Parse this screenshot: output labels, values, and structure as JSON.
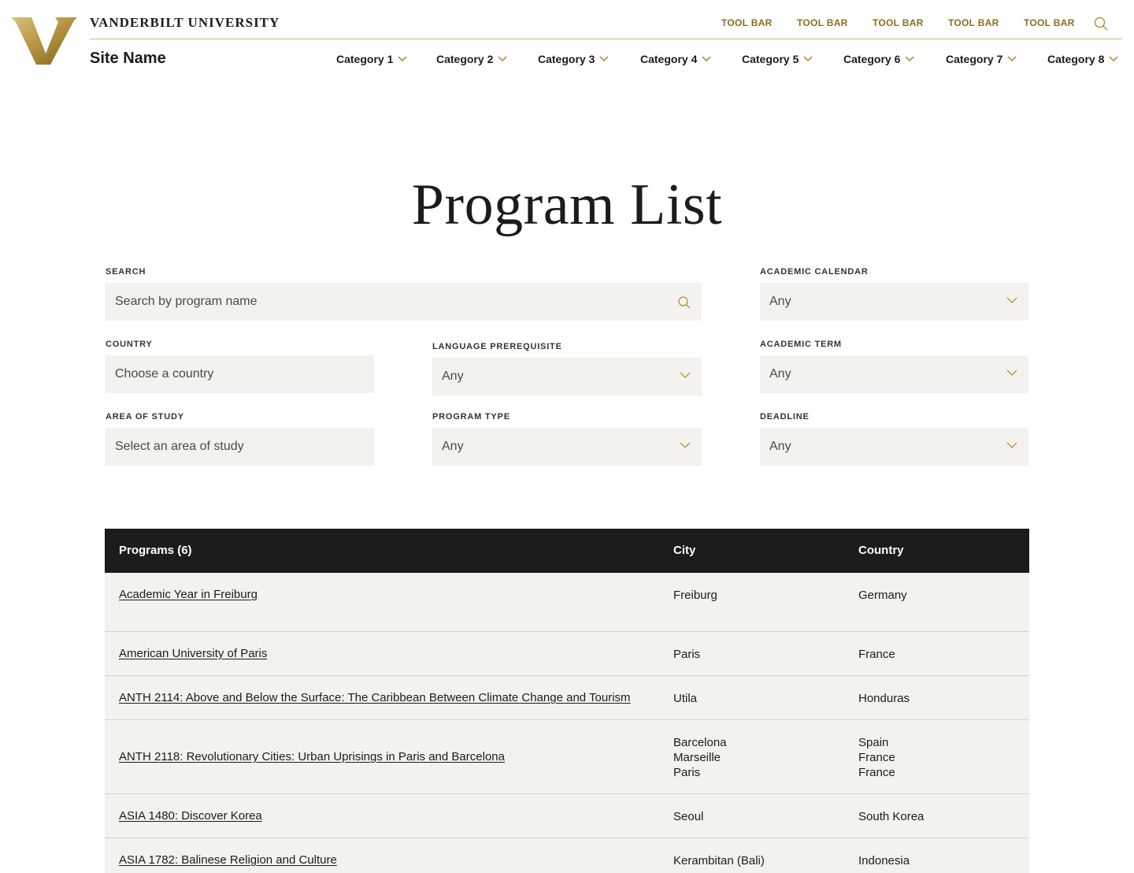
{
  "header": {
    "wordmark": "VANDERBILT UNIVERSITY",
    "site_name": "Site Name",
    "toolbar": [
      "TOOL BAR",
      "TOOL BAR",
      "TOOL BAR",
      "TOOL BAR",
      "TOOL BAR"
    ],
    "nav": [
      "Category 1",
      "Category 2",
      "Category 3",
      "Category 4",
      "Category 5",
      "Category 6",
      "Category 7",
      "Category 8"
    ],
    "accent_color": "#b3923f"
  },
  "page": {
    "title": "Program List"
  },
  "filters": {
    "search": {
      "label": "SEARCH",
      "placeholder": "Search by program name"
    },
    "academic_calendar": {
      "label": "ACADEMIC CALENDAR",
      "value": "Any"
    },
    "country": {
      "label": "COUNTRY",
      "placeholder": "Choose a country"
    },
    "language_prerequisite": {
      "label": "LANGUAGE PREREQUISITE",
      "value": "Any"
    },
    "academic_term": {
      "label": "ACADEMIC TERM",
      "value": "Any"
    },
    "area_of_study": {
      "label": "AREA OF STUDY",
      "placeholder": "Select an area of study"
    },
    "program_type": {
      "label": "PROGRAM TYPE",
      "value": "Any"
    },
    "deadline": {
      "label": "DEADLINE",
      "value": "Any"
    }
  },
  "table": {
    "headers": {
      "programs": "Programs (6)",
      "city": "City",
      "country": "Country"
    },
    "rows": [
      {
        "program": "Academic Year in Freiburg",
        "cities": [
          "Freiburg"
        ],
        "countries": [
          "Germany"
        ]
      },
      {
        "program": "American University of Paris",
        "cities": [
          "Paris"
        ],
        "countries": [
          "France"
        ]
      },
      {
        "program": "ANTH 2114: Above and Below the Surface: The Caribbean Between Climate Change and Tourism",
        "cities": [
          "Utila"
        ],
        "countries": [
          "Honduras"
        ]
      },
      {
        "program": "ANTH 2118: Revolutionary Cities: Urban Uprisings in Paris and Barcelona",
        "cities": [
          "Barcelona",
          "Marseille",
          "Paris"
        ],
        "countries": [
          "Spain",
          "France",
          "France"
        ]
      },
      {
        "program": "ASIA 1480: Discover Korea",
        "cities": [
          "Seoul"
        ],
        "countries": [
          "South Korea"
        ]
      },
      {
        "program": "ASIA 1782: Balinese Religion and Culture",
        "cities": [
          "Kerambitan (Bali)"
        ],
        "countries": [
          "Indonesia"
        ]
      }
    ]
  }
}
